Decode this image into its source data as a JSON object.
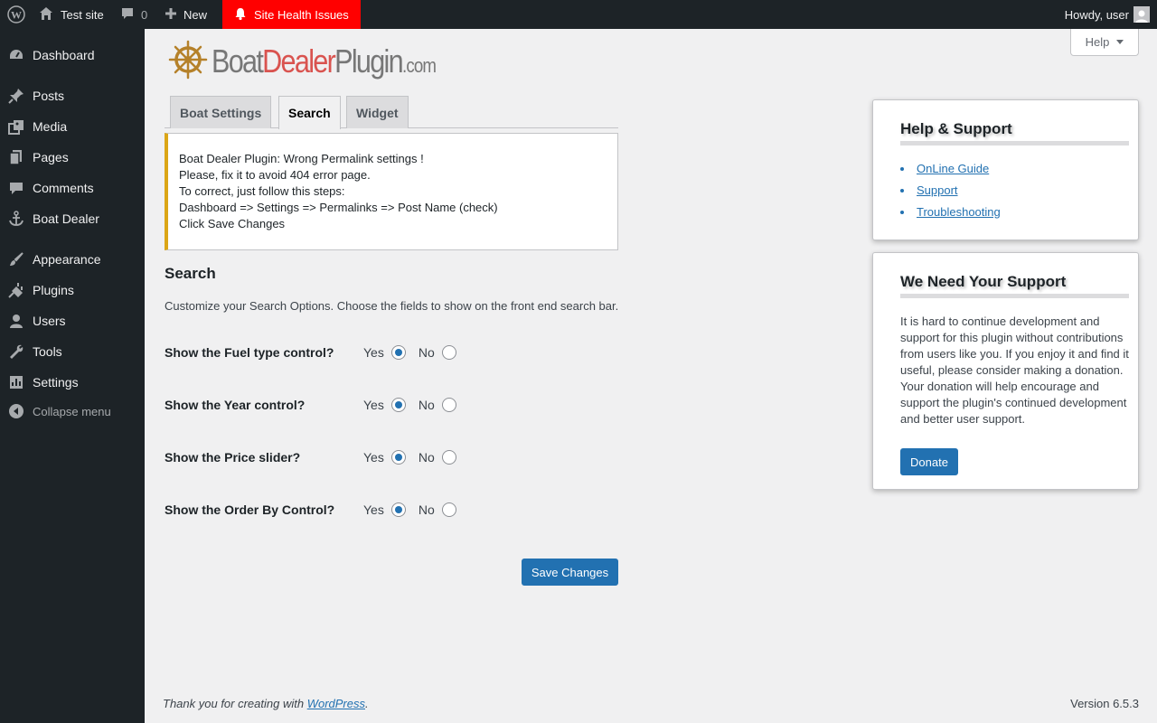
{
  "adminbar": {
    "site_name": "Test site",
    "comments_count": "0",
    "new_label": "New",
    "health_label": "Site Health Issues",
    "howdy": "Howdy, user"
  },
  "sidebar": {
    "items": [
      {
        "label": "Dashboard",
        "icon": "dashboard-icon"
      },
      {
        "label": "Posts",
        "icon": "pushpin-icon"
      },
      {
        "label": "Media",
        "icon": "media-icon"
      },
      {
        "label": "Pages",
        "icon": "pages-icon"
      },
      {
        "label": "Comments",
        "icon": "comment-icon"
      },
      {
        "label": "Boat Dealer",
        "icon": "anchor-icon"
      },
      {
        "label": "Appearance",
        "icon": "paintbrush-icon"
      },
      {
        "label": "Plugins",
        "icon": "plugin-icon"
      },
      {
        "label": "Users",
        "icon": "user-icon"
      },
      {
        "label": "Tools",
        "icon": "wrench-icon"
      },
      {
        "label": "Settings",
        "icon": "settings-icon"
      }
    ],
    "collapse_label": "Collapse menu"
  },
  "help_tab": "Help",
  "logo": {
    "part1": "Boat",
    "part2": "Dealer",
    "part3": "Plugin",
    "part4": ".com"
  },
  "tabs": [
    "Boat Settings",
    "Search",
    "Widget"
  ],
  "notice": {
    "lines": [
      "Boat Dealer Plugin: Wrong Permalink settings !",
      "Please, fix it to avoid 404 error page.",
      "To correct, just follow this steps:",
      "Dashboard => Settings => Permalinks => Post Name (check)",
      "Click Save Changes"
    ]
  },
  "search": {
    "title": "Search",
    "description": "Customize your Search Options. Choose the fields to show on the front end search bar.",
    "yes_label": "Yes",
    "no_label": "No",
    "options": [
      {
        "label": "Show the Fuel type control?",
        "value": "Yes"
      },
      {
        "label": "Show the Year control?",
        "value": "Yes"
      },
      {
        "label": "Show the Price slider?",
        "value": "Yes"
      },
      {
        "label": "Show the Order By Control?",
        "value": "Yes"
      }
    ],
    "save_label": "Save Changes"
  },
  "help_box": {
    "title": "Help & Support",
    "links": [
      "OnLine Guide",
      "Support",
      "Troubleshooting"
    ]
  },
  "support_box": {
    "title": "We Need Your Support",
    "text": "It is hard to continue development and support for this plugin without contributions from users like you. If you enjoy it and find it useful, please consider making a donation. Your donation will help encourage and support the plugin's continued development and better user support.",
    "donate_label": "Donate"
  },
  "footer": {
    "thanks_prefix": "Thank you for creating with ",
    "thanks_link": "WordPress",
    "thanks_suffix": ".",
    "version": "Version 6.5.3"
  },
  "colors": {
    "accent": "#2271b1",
    "health": "#ff0000",
    "notice_warning": "#dba617",
    "admin_dark": "#1d2327"
  }
}
